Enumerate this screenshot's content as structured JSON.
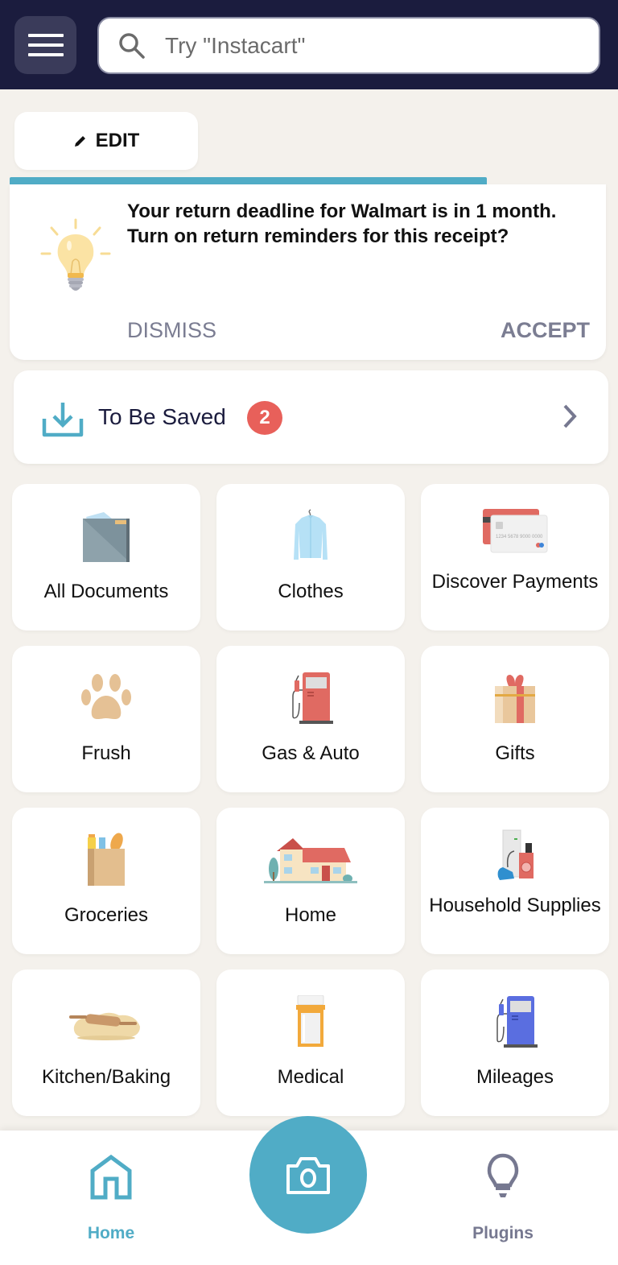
{
  "header": {
    "menu_icon": "hamburger-menu-icon",
    "search": {
      "placeholder": "Try \"Instacart\"",
      "value": "",
      "icon": "search-icon"
    }
  },
  "edit_button": {
    "label": "EDIT",
    "icon": "pencil-icon"
  },
  "tip_card": {
    "progress_fraction": 0.8,
    "icon": "lightbulb-icon",
    "message": "Your return deadline for Walmart is in 1 month. Turn on return reminders for this receipt?",
    "dismiss_label": "DISMISS",
    "accept_label": "ACCEPT"
  },
  "to_be_saved": {
    "icon": "download-icon",
    "label": "To Be Saved",
    "count": "2",
    "chevron": "chevron-right-icon"
  },
  "categories": [
    {
      "label": "All Documents",
      "icon": "folder-icon"
    },
    {
      "label": "Clothes",
      "icon": "shirt-icon"
    },
    {
      "label": "Discover Payments",
      "icon": "credit-cards-icon"
    },
    {
      "label": "Frush",
      "icon": "paw-print-icon"
    },
    {
      "label": "Gas & Auto",
      "icon": "gas-pump-icon"
    },
    {
      "label": "Gifts",
      "icon": "gift-box-icon"
    },
    {
      "label": "Groceries",
      "icon": "grocery-bag-icon"
    },
    {
      "label": "Home",
      "icon": "house-icon"
    },
    {
      "label": "Household Supplies",
      "icon": "appliances-icon"
    },
    {
      "label": "Kitchen/Baking",
      "icon": "rolling-pin-icon"
    },
    {
      "label": "Medical",
      "icon": "pill-bottle-icon"
    },
    {
      "label": "Mileages",
      "icon": "fuel-pump-icon"
    }
  ],
  "bottom_nav": {
    "home_label": "Home",
    "plugins_label": "Plugins",
    "camera_icon": "camera-icon",
    "active": "Home"
  },
  "colors": {
    "accent": "#50acc6",
    "header_bg": "#1b1c3e",
    "badge": "#e8605a",
    "muted": "#7b7d92",
    "page_bg": "#f4f1ec"
  }
}
